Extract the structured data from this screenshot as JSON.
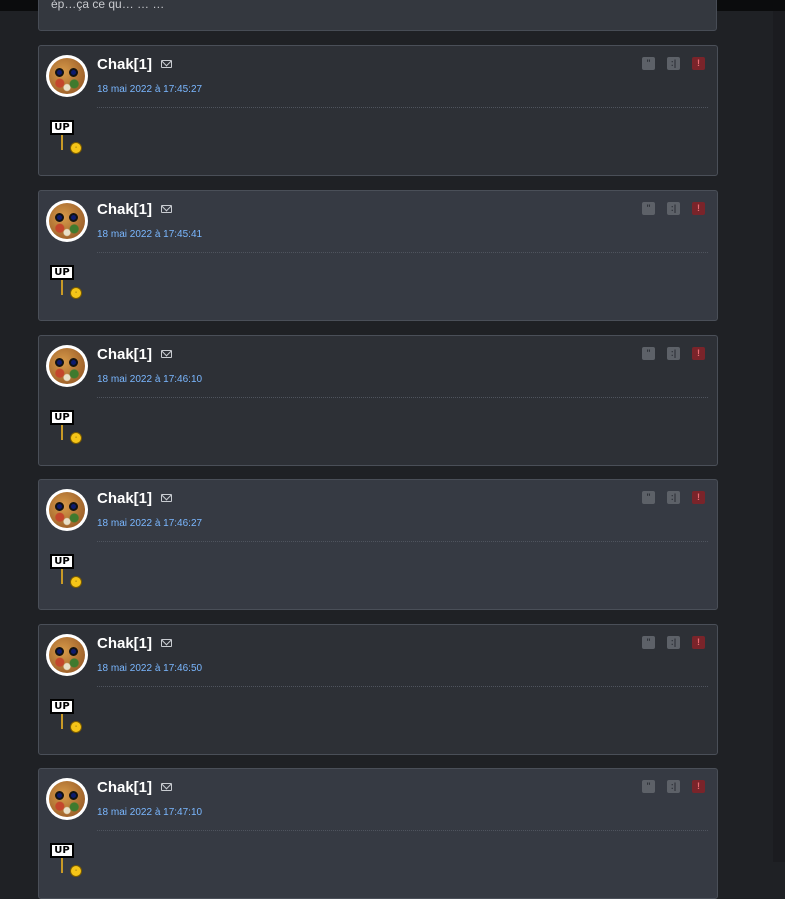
{
  "previous_post": {
    "text": "ép…ça ce qu… … …"
  },
  "actions": {
    "quote_icon": "quote-icon",
    "mp_icon": "private-message-icon",
    "alert_icon": "alert-icon"
  },
  "posts": [
    {
      "username": "Chak[1]",
      "timestamp": "18 mai 2022 à 17:45:27",
      "sticker_text": "UP"
    },
    {
      "username": "Chak[1]",
      "timestamp": "18 mai 2022 à 17:45:41",
      "sticker_text": "UP"
    },
    {
      "username": "Chak[1]",
      "timestamp": "18 mai 2022 à 17:46:10",
      "sticker_text": "UP"
    },
    {
      "username": "Chak[1]",
      "timestamp": "18 mai 2022 à 17:46:27",
      "sticker_text": "UP"
    },
    {
      "username": "Chak[1]",
      "timestamp": "18 mai 2022 à 17:46:50",
      "sticker_text": "UP"
    },
    {
      "username": "Chak[1]",
      "timestamp": "18 mai 2022 à 17:47:10",
      "sticker_text": "UP"
    }
  ]
}
